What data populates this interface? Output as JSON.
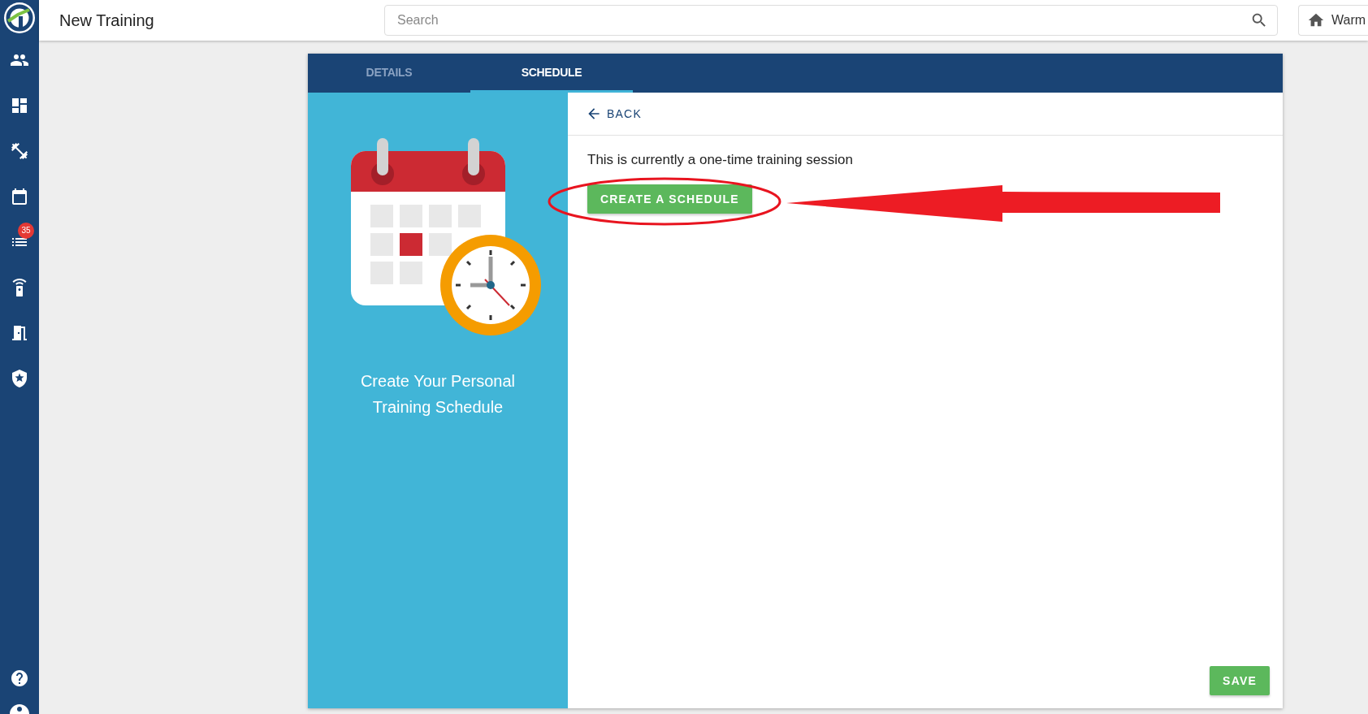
{
  "header": {
    "title": "New Training",
    "search": {
      "placeholder": "Search"
    },
    "location_button": "Warm"
  },
  "sidebar": {
    "notification_badge": "35"
  },
  "tabs": [
    {
      "label": "DETAILS",
      "selected": false
    },
    {
      "label": "SCHEDULE",
      "selected": true
    }
  ],
  "illustration": {
    "caption": "Create Your Personal Training Schedule"
  },
  "back_link": "BACK",
  "message": "This is currently a one-time training session",
  "create_button": "CREATE A SCHEDULE",
  "save_button": "SAVE"
}
